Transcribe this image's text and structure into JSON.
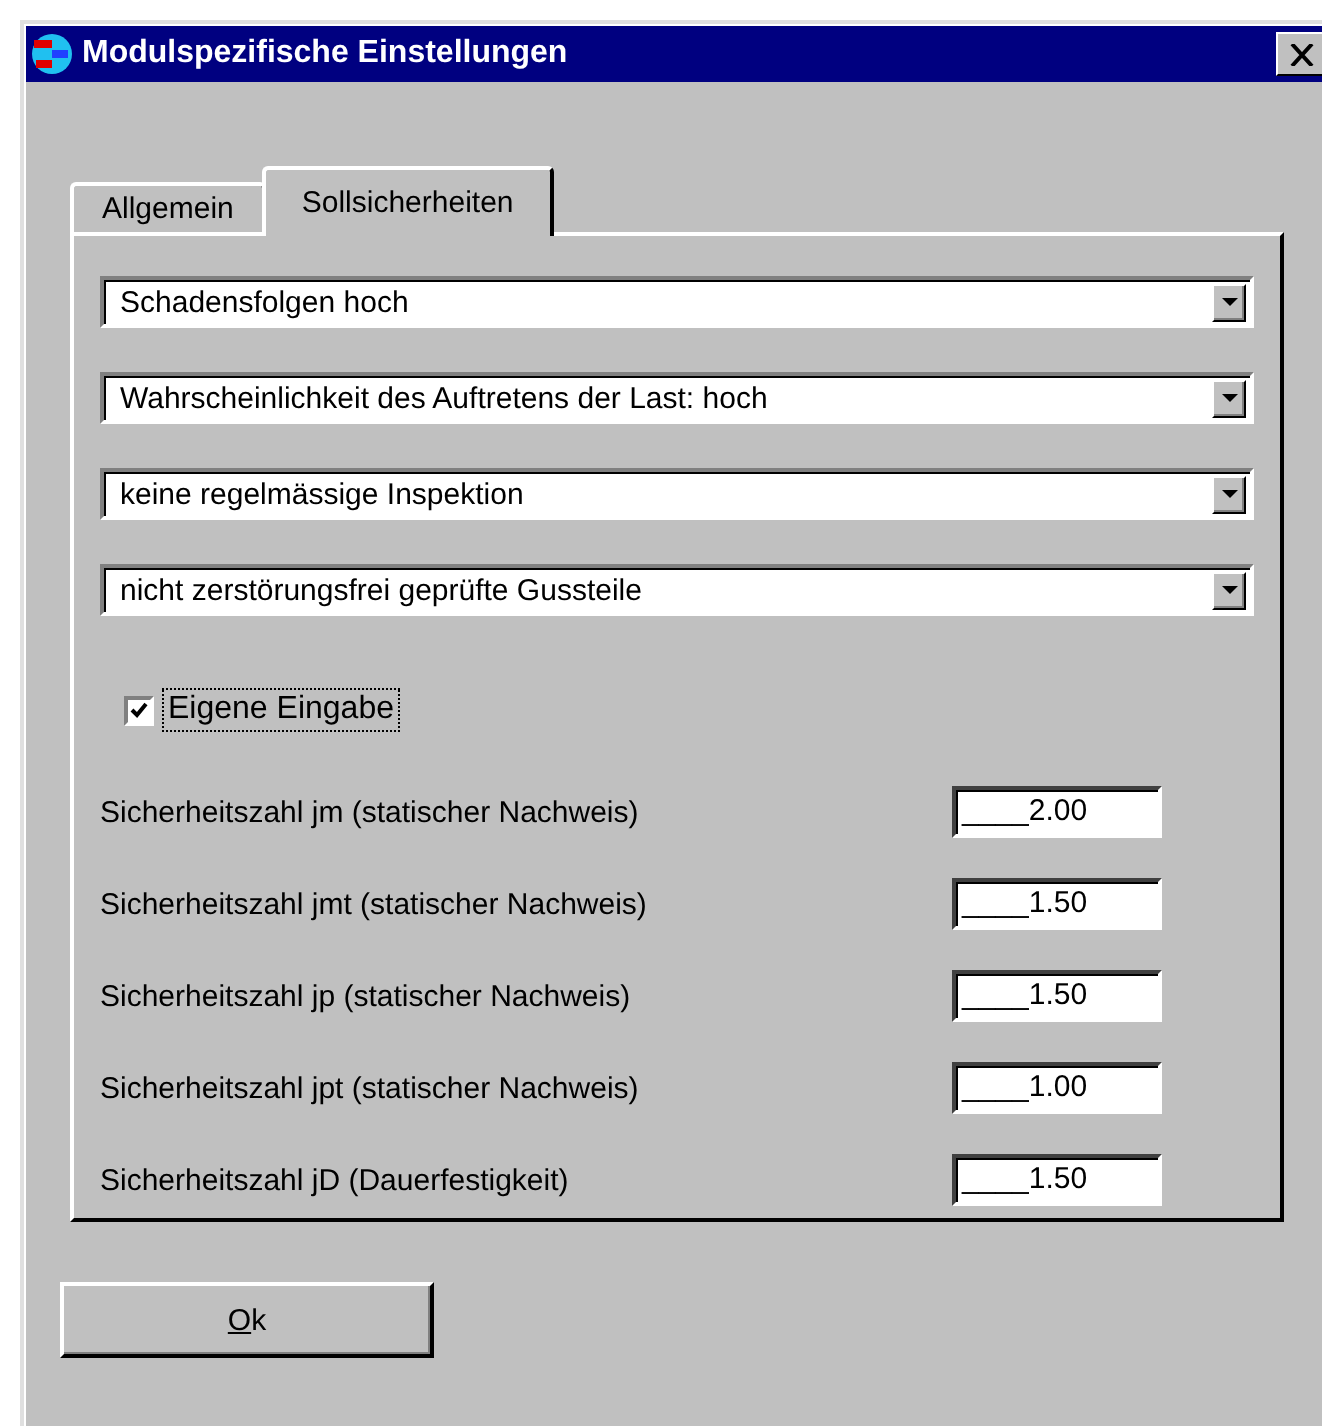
{
  "window": {
    "title": "Modulspezifische Einstellungen"
  },
  "tabs": [
    {
      "label": "Allgemein",
      "selected": false
    },
    {
      "label": "Sollsicherheiten",
      "selected": true
    }
  ],
  "dropdowns": [
    {
      "value": "Schadensfolgen hoch"
    },
    {
      "value": "Wahrscheinlichkeit des Auftretens der Last: hoch"
    },
    {
      "value": "keine regelmässige Inspektion"
    },
    {
      "value": "nicht zerstörungsfrei geprüfte Gussteile"
    }
  ],
  "custom_input": {
    "label": "Eigene Eingabe",
    "checked": true,
    "focused": true
  },
  "factors": [
    {
      "label": "Sicherheitszahl jm (statischer Nachweis)",
      "value": "____2.00"
    },
    {
      "label": "Sicherheitszahl jmt (statischer Nachweis)",
      "value": "____1.50"
    },
    {
      "label": "Sicherheitszahl jp (statischer Nachweis)",
      "value": "____1.50"
    },
    {
      "label": "Sicherheitszahl jpt (statischer Nachweis)",
      "value": "____1.00"
    },
    {
      "label": "Sicherheitszahl jD (Dauerfestigkeit)",
      "value": "____1.50"
    }
  ],
  "buttons": [
    {
      "label": "Ok"
    }
  ]
}
